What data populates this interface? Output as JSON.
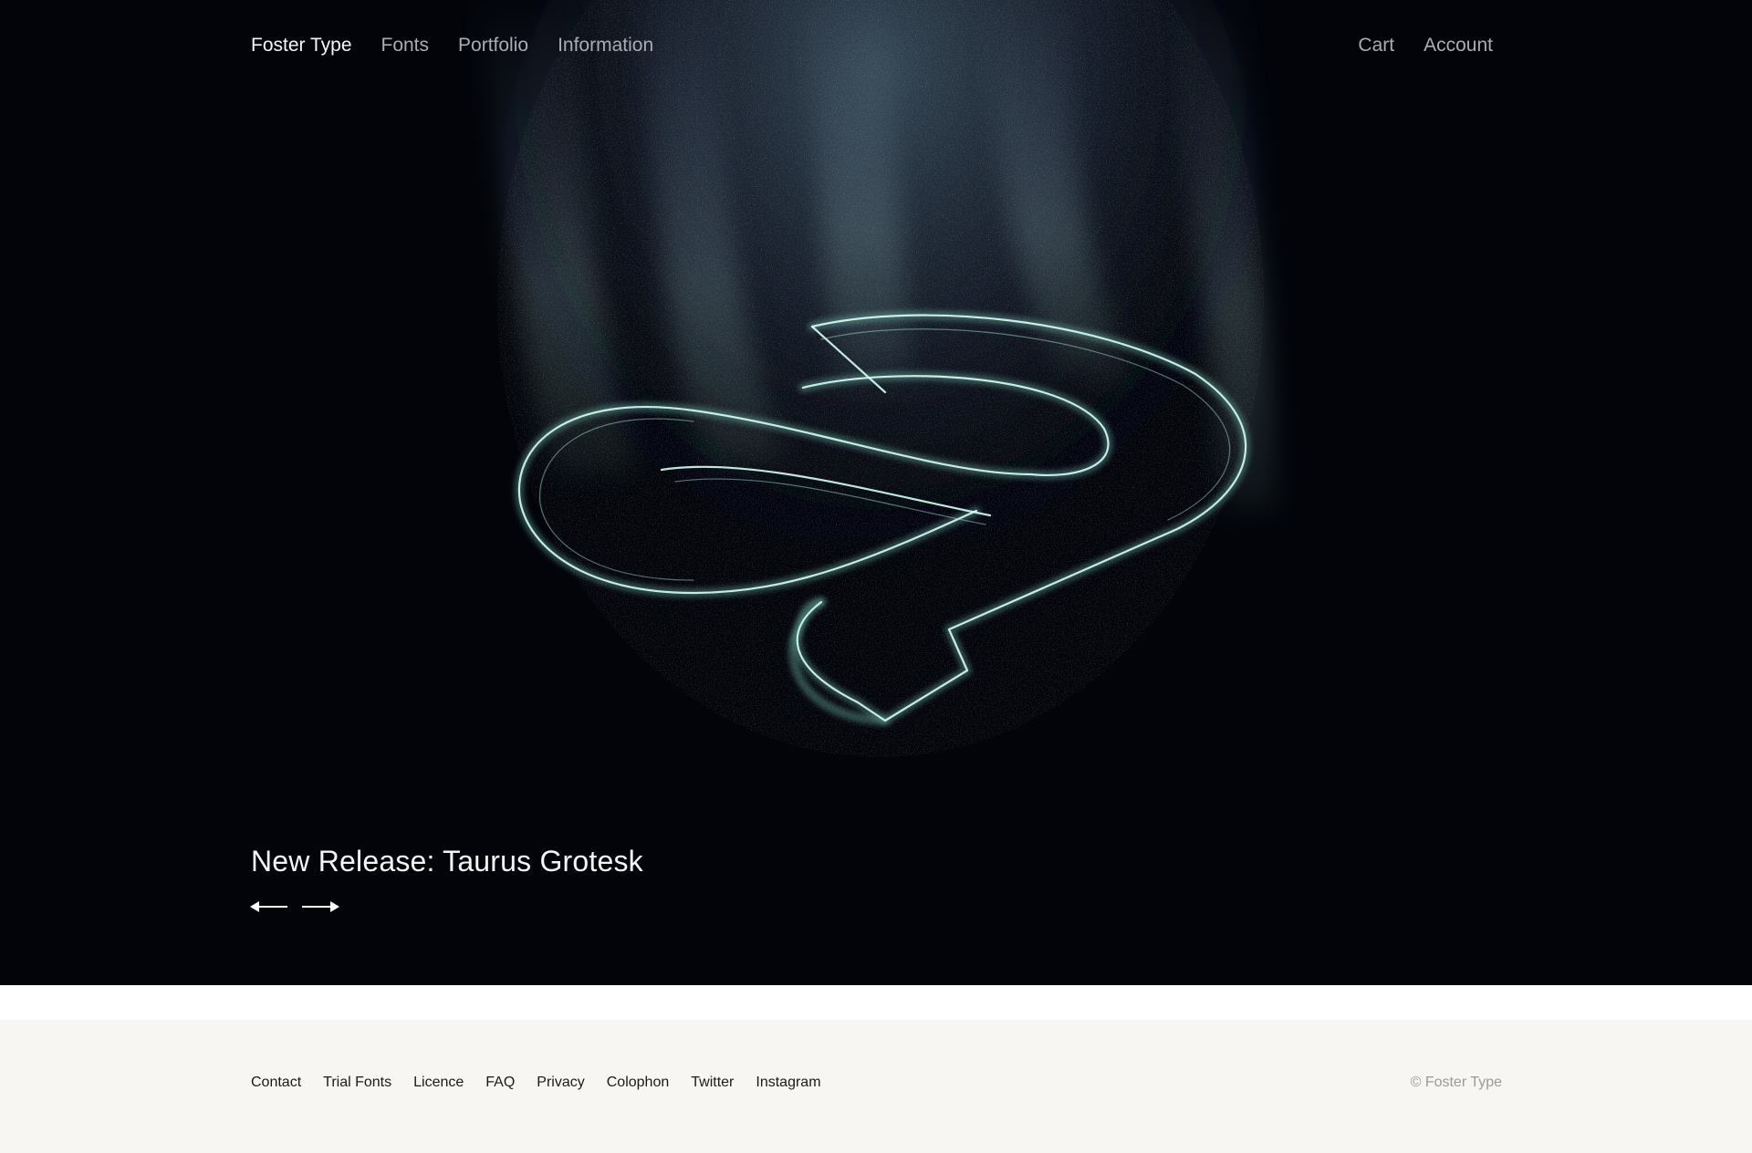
{
  "nav": {
    "brand": "Foster Type",
    "left": [
      "Fonts",
      "Portfolio",
      "Information"
    ],
    "right": [
      "Cart",
      "Account"
    ]
  },
  "hero": {
    "caption": "New Release: Taurus Grotesk",
    "prev_icon": "arrow-left-icon",
    "next_icon": "arrow-right-icon",
    "background": "#02040a",
    "glow_color": "#9fe0d2"
  },
  "footer": {
    "links": [
      "Contact",
      "Trial Fonts",
      "Licence",
      "FAQ",
      "Privacy",
      "Colophon",
      "Twitter",
      "Instagram"
    ],
    "copyright": "© Foster Type",
    "background": "#f7f6f3"
  }
}
